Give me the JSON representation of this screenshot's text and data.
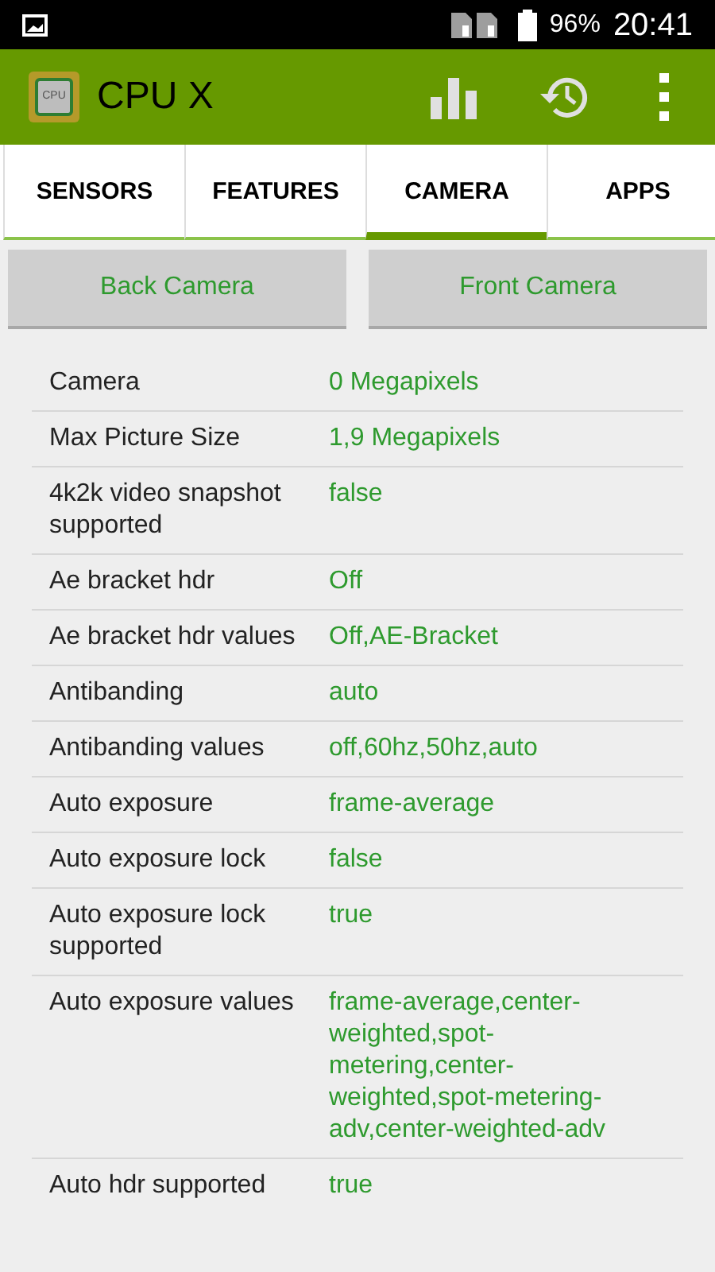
{
  "status_bar": {
    "battery": "96%",
    "time": "20:41"
  },
  "app_bar": {
    "icon_text": "CPU",
    "title": "CPU X"
  },
  "tabs": [
    {
      "label": "SENSORS",
      "selected": false
    },
    {
      "label": "FEATURES",
      "selected": false
    },
    {
      "label": "CAMERA",
      "selected": true
    },
    {
      "label": "APPS",
      "selected": false
    }
  ],
  "camera_buttons": [
    "Back Camera",
    "Front Camera"
  ],
  "rows": [
    {
      "label": "Camera",
      "value": "0 Megapixels"
    },
    {
      "label": "Max Picture Size",
      "value": "1,9 Megapixels"
    },
    {
      "label": "4k2k video snapshot supported",
      "value": "false"
    },
    {
      "label": "Ae bracket hdr",
      "value": "Off"
    },
    {
      "label": "Ae bracket hdr values",
      "value": "Off,AE-Bracket"
    },
    {
      "label": "Antibanding",
      "value": "auto"
    },
    {
      "label": "Antibanding values",
      "value": "off,60hz,50hz,auto"
    },
    {
      "label": "Auto exposure",
      "value": "frame-average"
    },
    {
      "label": "Auto exposure lock",
      "value": "false"
    },
    {
      "label": "Auto exposure lock supported",
      "value": "true"
    },
    {
      "label": "Auto exposure values",
      "value": "frame-average,center-weighted,spot-metering,center-weighted,spot-metering-adv,center-weighted-adv"
    },
    {
      "label": "Auto hdr supported",
      "value": "true"
    }
  ]
}
